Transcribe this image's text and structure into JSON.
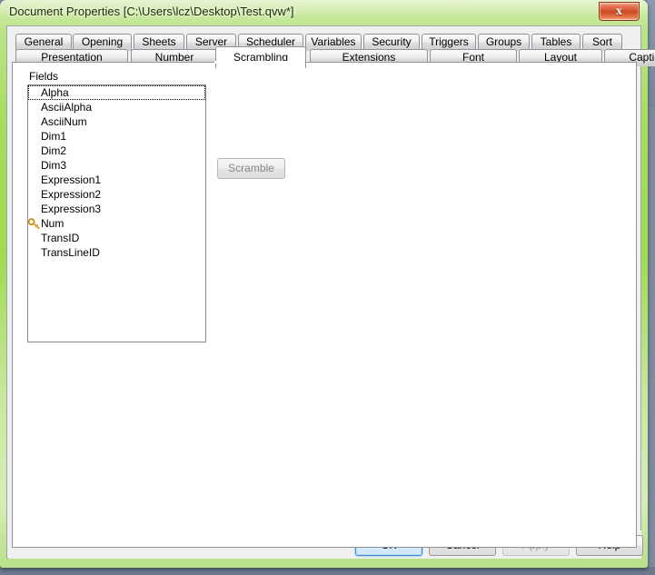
{
  "window": {
    "title": "Document Properties [C:\\Users\\lcz\\Desktop\\Test.qvw*]",
    "close_label": "x",
    "theme_accent": "#a6dd5a",
    "close_accent": "#d2502a"
  },
  "tabs": {
    "row1": [
      {
        "label": "General",
        "active": false
      },
      {
        "label": "Opening",
        "active": false
      },
      {
        "label": "Sheets",
        "active": false
      },
      {
        "label": "Server",
        "active": false
      },
      {
        "label": "Scheduler",
        "active": false
      },
      {
        "label": "Variables",
        "active": false
      },
      {
        "label": "Security",
        "active": false
      },
      {
        "label": "Triggers",
        "active": false
      },
      {
        "label": "Groups",
        "active": false
      },
      {
        "label": "Tables",
        "active": false
      },
      {
        "label": "Sort",
        "active": false
      }
    ],
    "row2": [
      {
        "label": "Presentation",
        "active": false
      },
      {
        "label": "Number",
        "active": false
      },
      {
        "label": "Scrambling",
        "active": true
      },
      {
        "label": "Extensions",
        "active": false
      },
      {
        "label": "Font",
        "active": false
      },
      {
        "label": "Layout",
        "active": false
      },
      {
        "label": "Caption",
        "active": false
      }
    ]
  },
  "panel": {
    "fields_label": "Fields",
    "fields": [
      {
        "name": "Alpha",
        "key": false,
        "focused": true
      },
      {
        "name": "AsciiAlpha",
        "key": false,
        "focused": false
      },
      {
        "name": "AsciiNum",
        "key": false,
        "focused": false
      },
      {
        "name": "Dim1",
        "key": false,
        "focused": false
      },
      {
        "name": "Dim2",
        "key": false,
        "focused": false
      },
      {
        "name": "Dim3",
        "key": false,
        "focused": false
      },
      {
        "name": "Expression1",
        "key": false,
        "focused": false
      },
      {
        "name": "Expression2",
        "key": false,
        "focused": false
      },
      {
        "name": "Expression3",
        "key": false,
        "focused": false
      },
      {
        "name": "Num",
        "key": true,
        "focused": false
      },
      {
        "name": "TransID",
        "key": false,
        "focused": false
      },
      {
        "name": "TransLineID",
        "key": false,
        "focused": false
      }
    ],
    "scramble_button": {
      "label": "Scramble",
      "disabled": true
    }
  },
  "footer": {
    "buttons": [
      {
        "id": "ok",
        "label": "OK",
        "disabled": false,
        "focused": true
      },
      {
        "id": "cancel",
        "label": "Cancel",
        "disabled": false,
        "focused": false
      },
      {
        "id": "apply",
        "label": "Apply",
        "disabled": true,
        "focused": false
      },
      {
        "id": "help",
        "label": "Help",
        "disabled": false,
        "focused": false
      }
    ]
  }
}
